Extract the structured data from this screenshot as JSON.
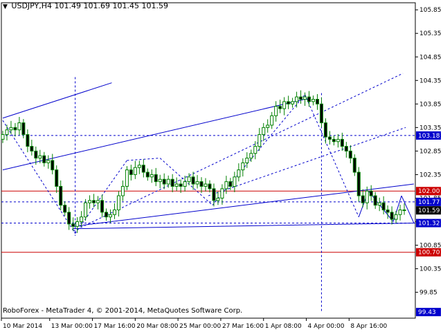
{
  "window": {
    "title": "USDJPY,H4  101.49 101.69 101.45 101.59",
    "copyright": "RoboForex - MetaTrader 4, © 2001-2014, MetaQuotes Software Corp."
  },
  "colors": {
    "background": "#ffffff",
    "candle_up_fill": "#ffffff",
    "candle_down_fill": "#000000",
    "candle_border": "#008000",
    "trend_line": "#0000cc",
    "red_level": "#cc0000",
    "blue_tag": "#0000cc",
    "red_tag": "#cc0000"
  },
  "chart_data": {
    "type": "candlestick",
    "symbol": "USDJPY",
    "timeframe": "H4",
    "ylim": [
      99.3,
      106.0
    ],
    "x_range": [
      0,
      600
    ],
    "y_ticks": [
      105.85,
      105.35,
      104.85,
      104.35,
      103.85,
      103.35,
      102.85,
      102.35,
      101.85,
      101.35,
      100.85,
      100.35,
      99.85
    ],
    "x_ticks": [
      {
        "x": 0,
        "label": "10 Mar 2014"
      },
      {
        "x": 70,
        "label": "13 Mar 00:00"
      },
      {
        "x": 132,
        "label": "17 Mar 16:00"
      },
      {
        "x": 194,
        "label": "20 Mar 08:00"
      },
      {
        "x": 256,
        "label": "25 Mar 00:00"
      },
      {
        "x": 318,
        "label": "27 Mar 16:00"
      },
      {
        "x": 380,
        "label": "1 Apr 08:00"
      },
      {
        "x": 442,
        "label": "4 Apr 00:00"
      },
      {
        "x": 504,
        "label": "8 Apr 16:00"
      }
    ],
    "price_tags": [
      {
        "value": 103.18,
        "label": "103.18",
        "color": "blue"
      },
      {
        "value": 102.0,
        "label": "102.00",
        "color": "red"
      },
      {
        "value": 101.77,
        "label": "101.77",
        "color": "blue"
      },
      {
        "value": 101.59,
        "label": "101.59",
        "color": "black"
      },
      {
        "value": 101.32,
        "label": "101.32",
        "color": "blue"
      },
      {
        "value": 100.7,
        "label": "100.70",
        "color": "red"
      },
      {
        "value": 99.43,
        "label": "99.43",
        "color": "blue"
      }
    ],
    "horizontal_levels": [
      {
        "value": 102.0,
        "style": "solid",
        "color": "red"
      },
      {
        "value": 100.7,
        "style": "solid",
        "color": "red"
      },
      {
        "value": 103.18,
        "style": "dashed",
        "color": "blue"
      },
      {
        "value": 101.77,
        "style": "dashed",
        "color": "blue"
      },
      {
        "value": 101.32,
        "style": "dashed",
        "color": "blue"
      }
    ],
    "vertical_levels": [
      {
        "x": 107,
        "y1": 104.42,
        "y2": 101.05
      },
      {
        "x": 464,
        "y1": 104.08,
        "y2": 99.43
      }
    ],
    "close_series": [
      [
        2,
        103.2
      ],
      [
        8,
        103.3
      ],
      [
        14,
        103.35
      ],
      [
        20,
        103.3
      ],
      [
        26,
        103.45
      ],
      [
        32,
        103.2
      ],
      [
        38,
        102.95
      ],
      [
        44,
        102.85
      ],
      [
        50,
        102.7
      ],
      [
        56,
        102.75
      ],
      [
        62,
        102.6
      ],
      [
        68,
        102.65
      ],
      [
        74,
        102.45
      ],
      [
        80,
        102.1
      ],
      [
        86,
        101.7
      ],
      [
        92,
        101.55
      ],
      [
        98,
        101.3
      ],
      [
        104,
        101.25
      ],
      [
        110,
        101.35
      ],
      [
        116,
        101.45
      ],
      [
        122,
        101.75
      ],
      [
        128,
        101.8
      ],
      [
        134,
        101.75
      ],
      [
        140,
        101.8
      ],
      [
        146,
        101.55
      ],
      [
        152,
        101.45
      ],
      [
        158,
        101.5
      ],
      [
        164,
        101.6
      ],
      [
        170,
        101.9
      ],
      [
        176,
        102.1
      ],
      [
        182,
        102.45
      ],
      [
        188,
        102.35
      ],
      [
        194,
        102.5
      ],
      [
        200,
        102.55
      ],
      [
        206,
        102.4
      ],
      [
        212,
        102.3
      ],
      [
        218,
        102.35
      ],
      [
        224,
        102.2
      ],
      [
        230,
        102.25
      ],
      [
        236,
        102.15
      ],
      [
        242,
        102.25
      ],
      [
        248,
        102.1
      ],
      [
        254,
        102.15
      ],
      [
        260,
        102.1
      ],
      [
        266,
        102.2
      ],
      [
        272,
        102.3
      ],
      [
        278,
        102.15
      ],
      [
        284,
        102.2
      ],
      [
        290,
        102.1
      ],
      [
        296,
        102.15
      ],
      [
        302,
        102.05
      ],
      [
        308,
        101.8
      ],
      [
        314,
        101.85
      ],
      [
        320,
        102.05
      ],
      [
        326,
        102.2
      ],
      [
        332,
        102.1
      ],
      [
        338,
        102.3
      ],
      [
        344,
        102.45
      ],
      [
        350,
        102.6
      ],
      [
        356,
        102.7
      ],
      [
        362,
        102.8
      ],
      [
        368,
        102.95
      ],
      [
        374,
        103.2
      ],
      [
        380,
        103.35
      ],
      [
        386,
        103.4
      ],
      [
        392,
        103.6
      ],
      [
        398,
        103.8
      ],
      [
        404,
        103.75
      ],
      [
        410,
        103.9
      ],
      [
        416,
        103.85
      ],
      [
        422,
        103.9
      ],
      [
        428,
        104.0
      ],
      [
        434,
        103.95
      ],
      [
        440,
        104.0
      ],
      [
        446,
        103.9
      ],
      [
        452,
        103.95
      ],
      [
        458,
        103.85
      ],
      [
        464,
        103.45
      ],
      [
        470,
        103.15
      ],
      [
        476,
        103.1
      ],
      [
        482,
        103.05
      ],
      [
        488,
        103.1
      ],
      [
        494,
        102.95
      ],
      [
        500,
        102.85
      ],
      [
        506,
        102.7
      ],
      [
        512,
        102.4
      ],
      [
        518,
        101.9
      ],
      [
        524,
        101.75
      ],
      [
        530,
        102.0
      ],
      [
        536,
        101.9
      ],
      [
        542,
        101.7
      ],
      [
        548,
        101.75
      ],
      [
        554,
        101.6
      ],
      [
        560,
        101.55
      ],
      [
        566,
        101.4
      ],
      [
        572,
        101.5
      ],
      [
        578,
        101.6
      ],
      [
        584,
        101.59
      ]
    ]
  }
}
